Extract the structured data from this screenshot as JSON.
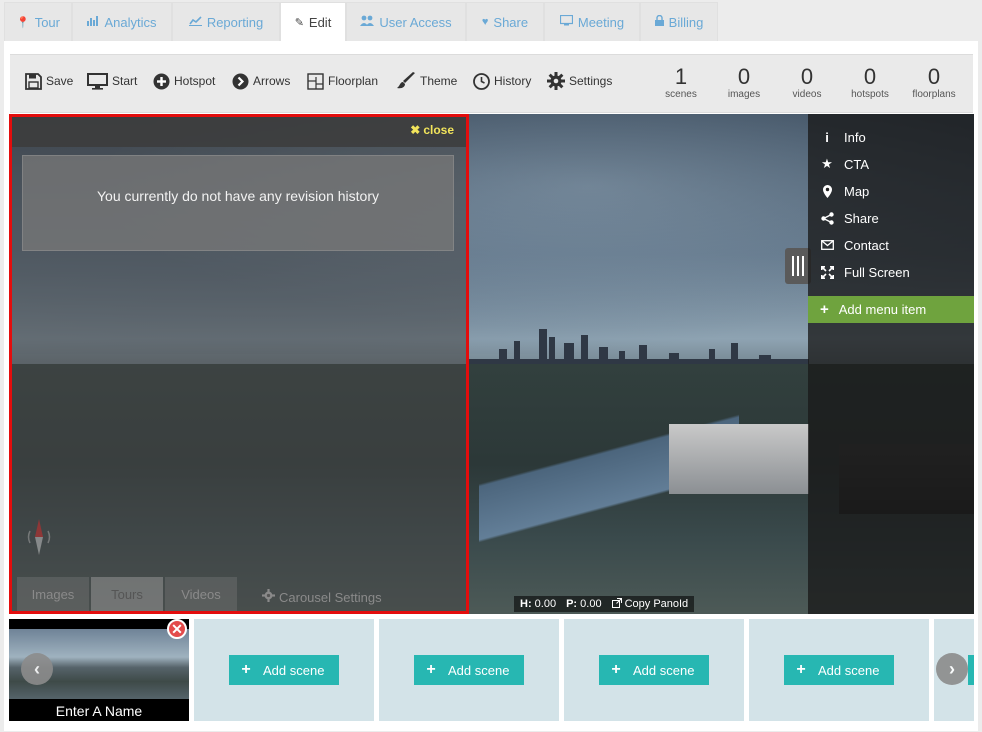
{
  "tabs": [
    {
      "label": "Tour",
      "icon": "map-marker-icon"
    },
    {
      "label": "Analytics",
      "icon": "bar-chart-icon"
    },
    {
      "label": "Reporting",
      "icon": "line-chart-icon"
    },
    {
      "label": "Edit",
      "icon": "pencil-icon"
    },
    {
      "label": "User Access",
      "icon": "users-icon"
    },
    {
      "label": "Share",
      "icon": "heart-icon"
    },
    {
      "label": "Meeting",
      "icon": "monitor-icon"
    },
    {
      "label": "Billing",
      "icon": "lock-icon"
    }
  ],
  "toolbar": {
    "tools": [
      {
        "label": "Save",
        "icon": "save-icon"
      },
      {
        "label": "Start",
        "icon": "monitor-icon"
      },
      {
        "label": "Hotspot",
        "icon": "plus-circle-icon"
      },
      {
        "label": "Arrows",
        "icon": "arrow-circle-icon"
      },
      {
        "label": "Floorplan",
        "icon": "floorplan-icon"
      },
      {
        "label": "Theme",
        "icon": "brush-icon"
      },
      {
        "label": "History",
        "icon": "clock-icon"
      },
      {
        "label": "Settings",
        "icon": "gear-icon"
      }
    ],
    "stats": [
      {
        "value": "1",
        "label": "scenes"
      },
      {
        "value": "0",
        "label": "images"
      },
      {
        "value": "0",
        "label": "videos"
      },
      {
        "value": "0",
        "label": "hotspots"
      },
      {
        "value": "0",
        "label": "floorplans"
      }
    ]
  },
  "history": {
    "close_label": "close",
    "message": "You currently do not have any revision history",
    "carousel_tabs": [
      "Images",
      "Tours",
      "Videos"
    ],
    "carousel_settings": "Carousel Settings"
  },
  "coords": {
    "h_label": "H:",
    "h_value": "0.00",
    "p_label": "P:",
    "p_value": "0.00",
    "copy_label": "Copy PanoId"
  },
  "menu": {
    "items": [
      {
        "label": "Info",
        "icon": "info-icon"
      },
      {
        "label": "CTA",
        "icon": "star-icon"
      },
      {
        "label": "Map",
        "icon": "map-marker-icon"
      },
      {
        "label": "Share",
        "icon": "share-icon"
      },
      {
        "label": "Contact",
        "icon": "envelope-icon"
      },
      {
        "label": "Full Screen",
        "icon": "expand-icon"
      }
    ],
    "add_label": "Add menu item"
  },
  "scenes": {
    "first_name": "Enter A Name",
    "add_label": "Add scene"
  },
  "colors": {
    "highlight_border": "#e30d0d",
    "close_text": "#f2e45b",
    "add_menu_bg": "#6fa33e",
    "add_scene_bg": "#27b7b2",
    "tab_text": "#6aa9d6"
  }
}
